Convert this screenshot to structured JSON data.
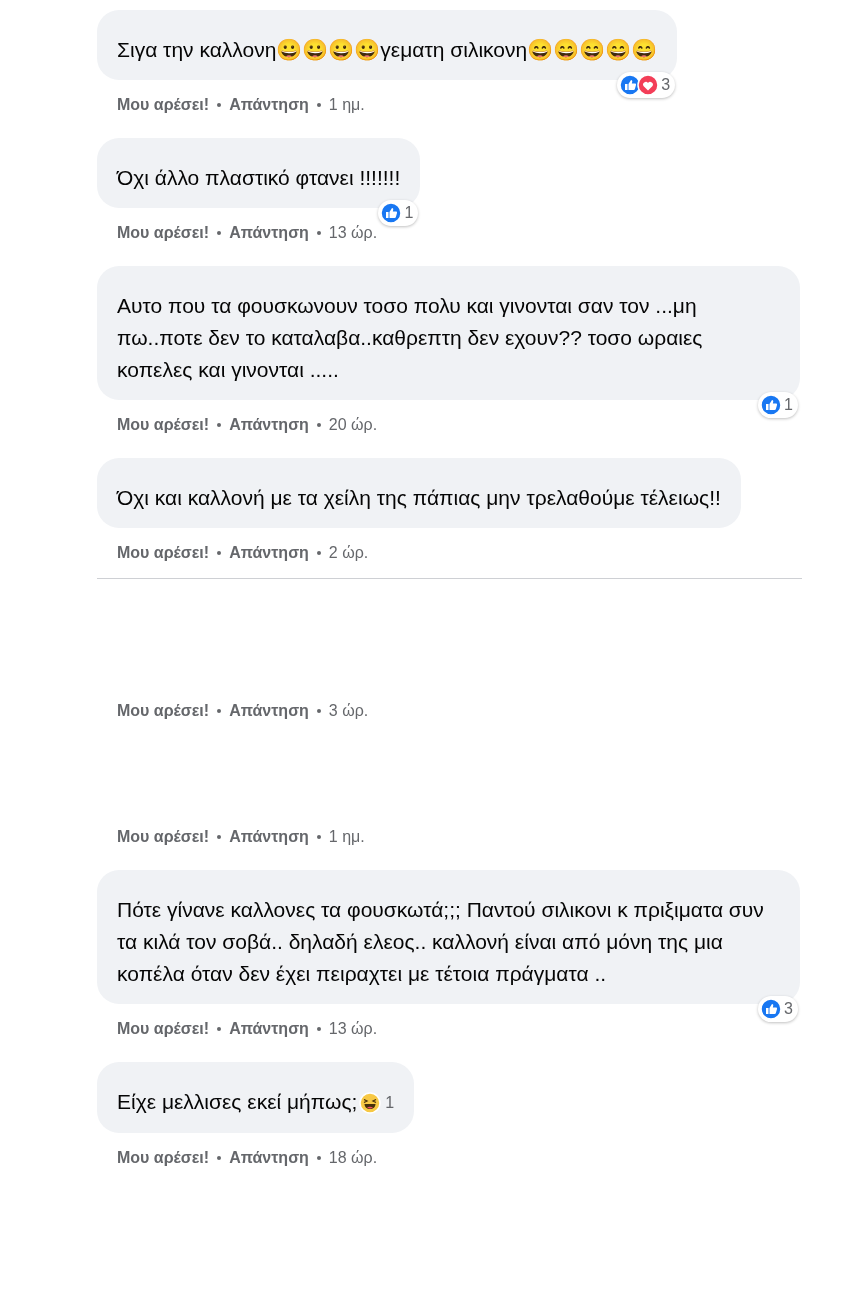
{
  "comments": [
    {
      "kind": "bubble",
      "text": "Σιγα την καλλονη😀😀😀😀γεματη σιλικονη😄😄😄😄😄",
      "reactions": [
        {
          "kind": "like"
        },
        {
          "kind": "love"
        }
      ],
      "reaction_count": "3",
      "reaction_inline": false,
      "like_label": "Μου αρέσει!",
      "reply_label": "Απάντηση",
      "time": "1 ημ.",
      "divider_after": false
    },
    {
      "kind": "bubble",
      "text": "Όχι άλλο πλαστικό φτανει !!!!!!!",
      "reactions": [
        {
          "kind": "like"
        }
      ],
      "reaction_count": "1",
      "reaction_inline": false,
      "like_label": "Μου αρέσει!",
      "reply_label": "Απάντηση",
      "time": "13 ώρ.",
      "divider_after": false
    },
    {
      "kind": "bubble",
      "text": "Αυτο που τα φουσκωνουν τοσο πολυ και γινονται σαν τον ...μη πω..ποτε δεν το καταλαβα..καθρεπτη δεν εχουν?? τοσο ωραιες κοπελες και γινονται .....",
      "reactions": [
        {
          "kind": "like"
        }
      ],
      "reaction_count": "1",
      "reaction_inline": false,
      "like_label": "Μου αρέσει!",
      "reply_label": "Απάντηση",
      "time": "20 ώρ.",
      "divider_after": false
    },
    {
      "kind": "bubble",
      "text": "Όχι και καλλονή με τα χείλη της πάπιας μην τρελαθούμε τέλειως!!",
      "like_label": "Μου αρέσει!",
      "reply_label": "Απάντηση",
      "time": "2 ώρ.",
      "divider_after": true
    },
    {
      "kind": "blank",
      "like_label": "Μου αρέσει!",
      "reply_label": "Απάντηση",
      "time": "3 ώρ.",
      "divider_after": false
    },
    {
      "kind": "blank",
      "like_label": "Μου αρέσει!",
      "reply_label": "Απάντηση",
      "time": "1 ημ.",
      "divider_after": false
    },
    {
      "kind": "bubble",
      "text": "Πότε γίνανε καλλονες τα φουσκωτά;;; Παντού σιλικονι κ πριξιματα συν τα κιλά τον σοβά.. δηλαδή ελεος.. καλλονή είναι από μόνη της μια κοπέλα όταν δεν έχει πειραχτει με τέτοια πράγματα ..",
      "reactions": [
        {
          "kind": "like"
        }
      ],
      "reaction_count": "3",
      "reaction_inline": false,
      "like_label": "Μου αρέσει!",
      "reply_label": "Απάντηση",
      "time": "13 ώρ.",
      "divider_after": false
    },
    {
      "kind": "bubble",
      "text": "Είχε μελλισες εκεί μήπως;",
      "reactions": [
        {
          "kind": "haha"
        }
      ],
      "reaction_count": "1",
      "reaction_inline": true,
      "like_label": "Μου αρέσει!",
      "reply_label": "Απάντηση",
      "time": "18 ώρ.",
      "divider_after": false
    }
  ]
}
